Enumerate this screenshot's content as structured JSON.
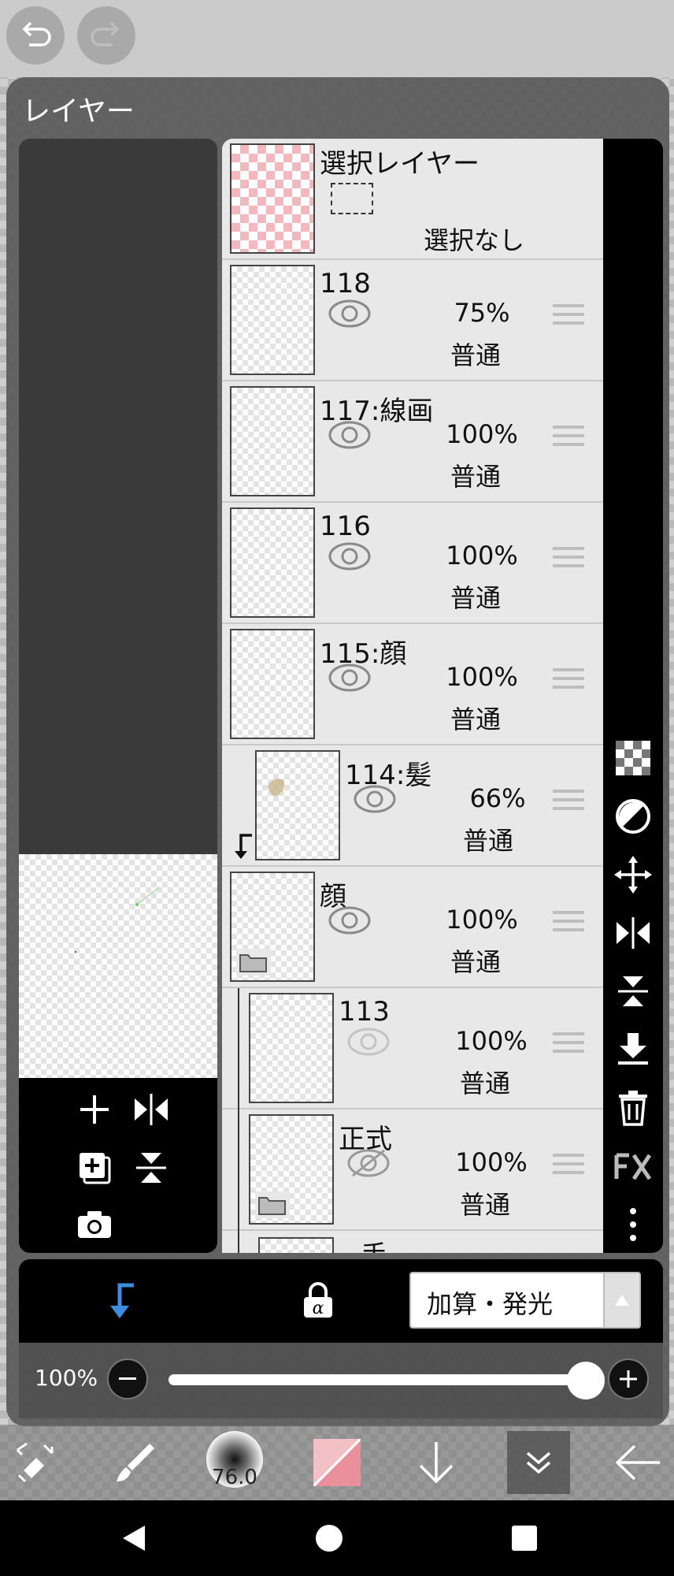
{
  "panel": {
    "title": "レイヤー"
  },
  "selection_layer": {
    "name": "選択レイヤー",
    "status": "選択なし"
  },
  "layers": [
    {
      "name": "118",
      "opacity": "75%",
      "blend": "普通"
    },
    {
      "name": "117:線画",
      "opacity": "100%",
      "blend": "普通"
    },
    {
      "name": "116",
      "opacity": "100%",
      "blend": "普通"
    },
    {
      "name": "115:顔",
      "opacity": "100%",
      "blend": "普通"
    },
    {
      "name": "114:髪",
      "opacity": "66%",
      "blend": "普通"
    },
    {
      "name": "顔",
      "opacity": "100%",
      "blend": "普通"
    },
    {
      "name": "113",
      "opacity": "100%",
      "blend": "普通"
    },
    {
      "name": "正式",
      "opacity": "100%",
      "blend": "普通"
    },
    {
      "name": "手"
    }
  ],
  "blend_mode": {
    "selected": "加算・発光"
  },
  "opacity_slider": {
    "label": "100%",
    "value_percent": 100
  },
  "brush": {
    "size": "76.0"
  },
  "colors": {
    "accent_blue": "#3b8de0",
    "current_color": "#e9909c",
    "selection_checker": "#f3b8bd"
  },
  "icons": {
    "undo": "undo-icon",
    "redo": "redo-icon",
    "add": "plus-icon",
    "flip": "flip-horizontal-icon",
    "duplicate": "duplicate-layer-icon",
    "merge": "merge-down-icon",
    "camera": "camera-icon",
    "checker": "transparency-icon",
    "clip": "clipping-icon",
    "move": "move-icon",
    "delete": "trash-icon",
    "fx": "fx-icon",
    "more": "more-vertical-icon"
  }
}
